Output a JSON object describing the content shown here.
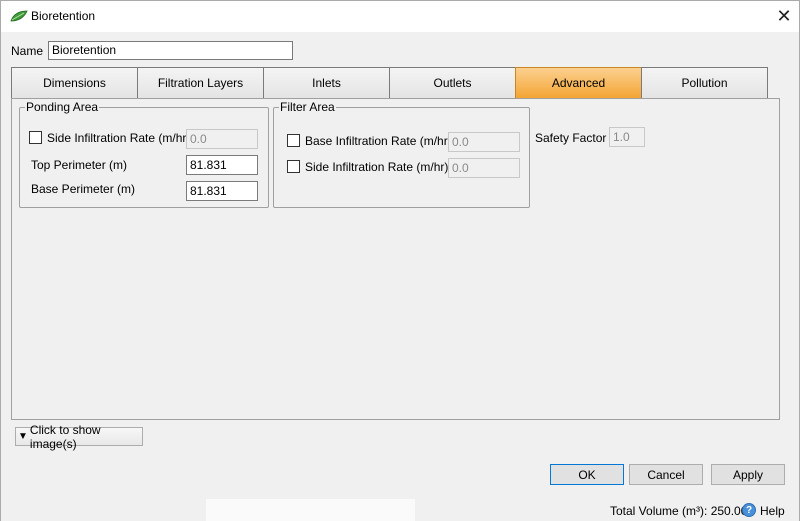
{
  "window": {
    "title": "Bioretention",
    "icon": "leaf-icon"
  },
  "name_field": {
    "label": "Name",
    "value": "Bioretention"
  },
  "tabs": [
    {
      "label": "Dimensions",
      "active": false
    },
    {
      "label": "Filtration Layers",
      "active": false
    },
    {
      "label": "Inlets",
      "active": false
    },
    {
      "label": "Outlets",
      "active": false
    },
    {
      "label": "Advanced",
      "active": true
    },
    {
      "label": "Pollution",
      "active": false
    }
  ],
  "ponding_area": {
    "title": "Ponding Area",
    "side_infiltration": {
      "label": "Side Infiltration Rate (m/hr)",
      "checked": false,
      "value": "0.0"
    },
    "top_perimeter": {
      "label": "Top Perimeter (m)",
      "value": "81.831"
    },
    "base_perimeter": {
      "label": "Base Perimeter (m)",
      "value": "81.831"
    }
  },
  "filter_area": {
    "title": "Filter Area",
    "base_infiltration": {
      "label": "Base Infiltration Rate (m/hr)",
      "checked": false,
      "value": "0.0"
    },
    "side_infiltration": {
      "label": "Side Infiltration Rate (m/hr)",
      "checked": false,
      "value": "0.0"
    }
  },
  "safety_factor": {
    "label": "Safety Factor",
    "value": "1.0"
  },
  "show_images": {
    "label": "Click to show image(s)"
  },
  "buttons": {
    "ok": "OK",
    "cancel": "Cancel",
    "apply": "Apply"
  },
  "status": {
    "total_volume": "Total Volume (m³): 250.000",
    "help": "Help"
  },
  "colors": {
    "active_tab": "#f4a534",
    "accent": "#0078d7"
  }
}
